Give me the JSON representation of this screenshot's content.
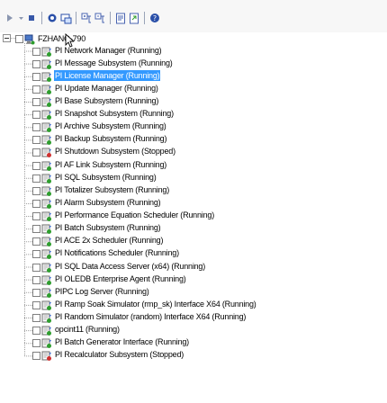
{
  "toolbar": {
    "buttons": [
      {
        "icon": "arrow-right-icon"
      },
      {
        "icon": "dropdown-arrow-icon"
      },
      {
        "icon": "stop-icon"
      },
      {
        "icon": "start-icon"
      },
      {
        "icon": "services-icon"
      },
      {
        "icon": "expand-icon"
      },
      {
        "icon": "collapse-icon"
      },
      {
        "icon": "properties-icon"
      },
      {
        "icon": "export-icon"
      },
      {
        "icon": "help-icon"
      }
    ]
  },
  "tree": {
    "root": {
      "label": "FZHANG-790",
      "icon": "server-icon"
    },
    "items": [
      {
        "label": "PI Network Manager (Running)",
        "status": "running"
      },
      {
        "label": "PI Message Subsystem (Running)",
        "status": "running"
      },
      {
        "label": "PI License Manager (Running)",
        "status": "running",
        "selected": true
      },
      {
        "label": "PI Update Manager (Running)",
        "status": "running"
      },
      {
        "label": "PI Base Subsystem (Running)",
        "status": "running"
      },
      {
        "label": "PI Snapshot Subsystem (Running)",
        "status": "running"
      },
      {
        "label": "PI Archive Subsystem (Running)",
        "status": "running"
      },
      {
        "label": "PI Backup Subsystem (Running)",
        "status": "running"
      },
      {
        "label": "PI Shutdown Subsystem (Stopped)",
        "status": "stopped"
      },
      {
        "label": "PI AF Link Subsystem (Running)",
        "status": "running"
      },
      {
        "label": "PI SQL Subsystem (Running)",
        "status": "running"
      },
      {
        "label": "PI Totalizer Subsystem (Running)",
        "status": "running"
      },
      {
        "label": "PI Alarm Subsystem (Running)",
        "status": "running"
      },
      {
        "label": "PI Performance Equation Scheduler (Running)",
        "status": "running"
      },
      {
        "label": "PI Batch Subsystem (Running)",
        "status": "running"
      },
      {
        "label": "PI ACE 2x Scheduler (Running)",
        "status": "running"
      },
      {
        "label": "PI Notifications Scheduler (Running)",
        "status": "running"
      },
      {
        "label": "PI SQL Data Access Server (x64) (Running)",
        "status": "running"
      },
      {
        "label": "PI OLEDB Enterprise Agent (Running)",
        "status": "running"
      },
      {
        "label": "PIPC Log Server (Running)",
        "status": "running"
      },
      {
        "label": "PI Ramp Soak Simulator (rmp_sk) Interface X64 (Running)",
        "status": "running"
      },
      {
        "label": "PI Random Simulator (random) Interface X64 (Running)",
        "status": "running"
      },
      {
        "label": "opcint11 (Running)",
        "status": "running"
      },
      {
        "label": "PI Batch Generator Interface (Running)",
        "status": "running"
      },
      {
        "label": "PI Recalculator Subsystem (Stopped)",
        "status": "stopped"
      }
    ]
  },
  "colors": {
    "selection": "#3399ff",
    "running": "#2e9e2e",
    "stopped": "#d03030"
  }
}
